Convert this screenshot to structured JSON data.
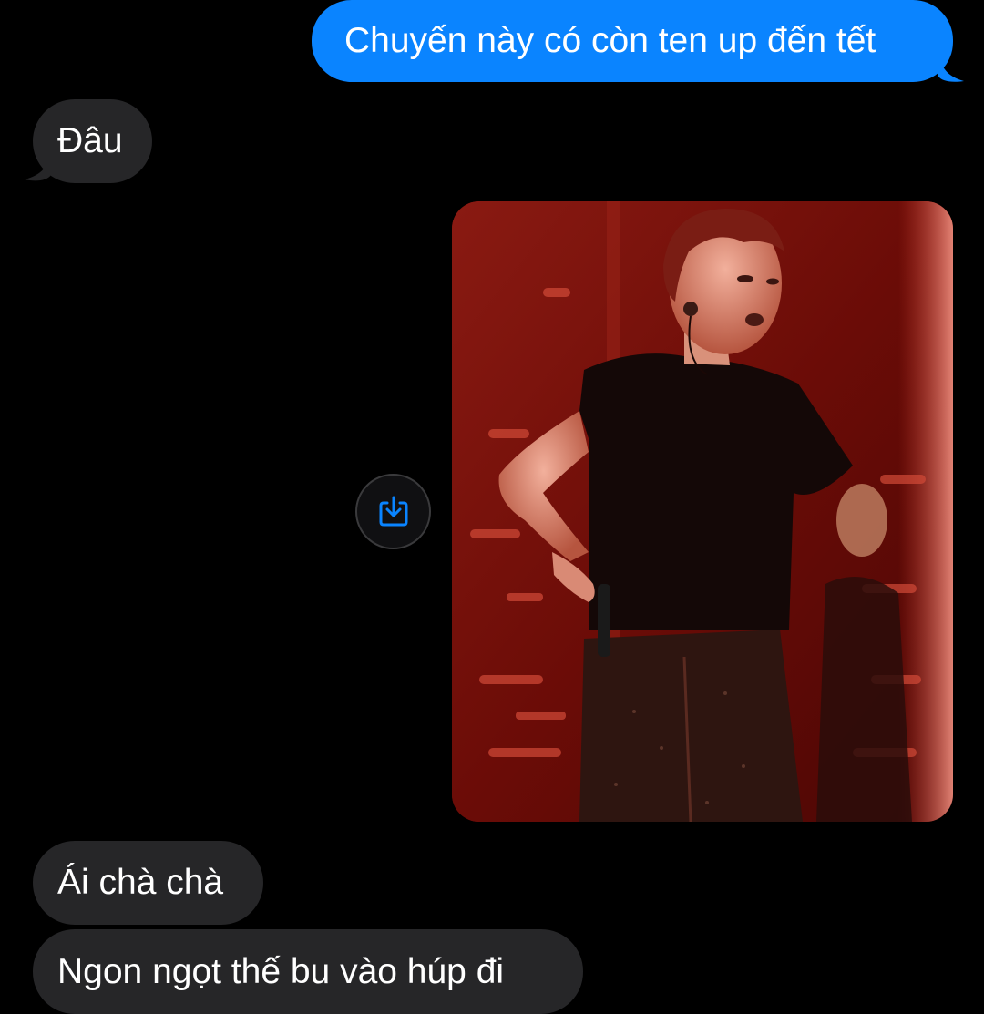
{
  "messages": [
    {
      "id": "msg1",
      "direction": "outgoing",
      "text": "Chuyến này có còn ten up đến tết"
    },
    {
      "id": "msg2",
      "direction": "incoming",
      "text": "Đâu"
    },
    {
      "id": "msg3",
      "direction": "outgoing",
      "type": "photo",
      "icon": "concert-performer-photo"
    },
    {
      "id": "msg4",
      "direction": "incoming",
      "text": "Ái chà chà"
    },
    {
      "id": "msg5",
      "direction": "incoming",
      "text": "Ngon ngọt thế bu vào húp đi"
    }
  ],
  "photo_action": {
    "icon": "save-share-icon"
  },
  "colors": {
    "background": "#000000",
    "outgoing_bubble": "#0a84ff",
    "incoming_bubble": "#262628",
    "text": "#ffffff",
    "icon_accent": "#0a84ff"
  }
}
